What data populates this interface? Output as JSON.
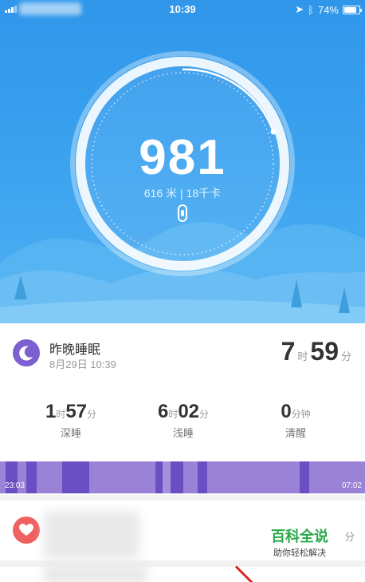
{
  "status_bar": {
    "time": "10:39",
    "battery": "74%"
  },
  "steps": {
    "count": "981",
    "summary": "616 米 | 18千卡"
  },
  "sleep": {
    "title": "昨晚睡眠",
    "date": "8月29日 10:39",
    "total_hours": "7",
    "hour_unit": "时",
    "total_minutes": "59",
    "minute_unit": "分",
    "stats": [
      {
        "hours": "1",
        "hour_unit": "时",
        "minutes": "57",
        "minute_unit": "分",
        "label": "深睡"
      },
      {
        "hours": "6",
        "hour_unit": "时",
        "minutes": "02",
        "minute_unit": "分",
        "label": "浅睡"
      },
      {
        "minutes": "0",
        "minute_unit": "分钟",
        "label": "清醒"
      }
    ],
    "bar_start": "23:03",
    "bar_end": "07:02"
  },
  "heart": {
    "unit": "分"
  },
  "watermark": {
    "title": "百科全说",
    "subtitle": "助你轻松解决"
  },
  "colors": {
    "hero": "#3aa1ef",
    "sleep_deep": "#6a4fc2",
    "sleep_light": "#9a83d6",
    "heart": "#f06060"
  },
  "icons": [
    "signal-icon",
    "location-icon",
    "bluetooth-icon",
    "battery-icon",
    "band-icon",
    "moon-icon",
    "heart-icon"
  ]
}
